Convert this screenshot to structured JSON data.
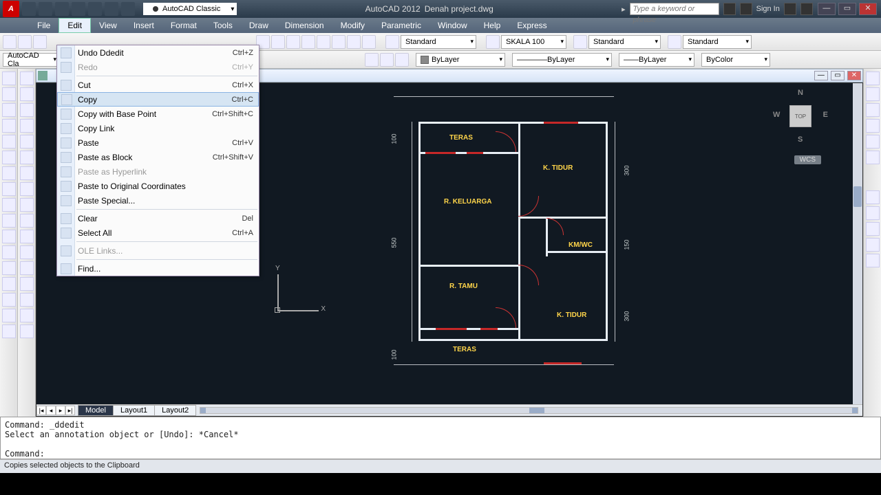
{
  "title_app": "AutoCAD 2012",
  "title_file": "Denah project.dwg",
  "workspace": "AutoCAD Classic",
  "search_ph": "Type a keyword or phrase",
  "signin": "Sign In",
  "menu": [
    "File",
    "Edit",
    "View",
    "Insert",
    "Format",
    "Tools",
    "Draw",
    "Dimension",
    "Modify",
    "Parametric",
    "Window",
    "Help",
    "Express"
  ],
  "edit_menu": [
    {
      "t": "section",
      "items": [
        {
          "label": "Undo Ddedit",
          "sc": "Ctrl+Z"
        },
        {
          "label": "Redo",
          "sc": "Ctrl+Y",
          "dis": true
        }
      ]
    },
    {
      "t": "section",
      "items": [
        {
          "label": "Cut",
          "sc": "Ctrl+X"
        },
        {
          "label": "Copy",
          "sc": "Ctrl+C",
          "hi": true
        },
        {
          "label": "Copy with Base Point",
          "sc": "Ctrl+Shift+C"
        },
        {
          "label": "Copy Link",
          "sc": ""
        },
        {
          "label": "Paste",
          "sc": "Ctrl+V"
        },
        {
          "label": "Paste as Block",
          "sc": "Ctrl+Shift+V"
        },
        {
          "label": "Paste as Hyperlink",
          "sc": "",
          "dis": true
        },
        {
          "label": "Paste to Original Coordinates",
          "sc": ""
        },
        {
          "label": "Paste Special...",
          "sc": ""
        }
      ]
    },
    {
      "t": "section",
      "items": [
        {
          "label": "Clear",
          "sc": "Del"
        },
        {
          "label": "Select All",
          "sc": "Ctrl+A"
        }
      ]
    },
    {
      "t": "section",
      "items": [
        {
          "label": "OLE Links...",
          "sc": "",
          "dis": true
        }
      ]
    },
    {
      "t": "section",
      "items": [
        {
          "label": "Find...",
          "sc": ""
        }
      ]
    }
  ],
  "combos": {
    "textstyle": "Standard",
    "dimstyle": "SKALA 100",
    "tablestyle": "Standard",
    "mlstyle": "Standard",
    "layer": "ByLayer",
    "lwt": "ByLayer",
    "ltype": "ByLayer",
    "color": "ByColor",
    "workspace2": "AutoCAD Cla"
  },
  "rooms": {
    "teras": "TERAS",
    "keluarga": "R. KELUARGA",
    "tamu": "R. TAMU",
    "tidur": "K. TIDUR",
    "kmwc": "KM/WC"
  },
  "dims": {
    "d100": "100",
    "d550": "550",
    "d300": "300",
    "d150": "150"
  },
  "tabs": {
    "model": "Model",
    "l1": "Layout1",
    "l2": "Layout2"
  },
  "cmd": "Command: _ddedit\nSelect an annotation object or [Undo]: *Cancel*\n\nCommand:",
  "status": "Copies selected objects to the Clipboard",
  "viewcube": {
    "top": "TOP",
    "n": "N",
    "s": "S",
    "e": "E",
    "w": "W"
  },
  "wcs": "WCS"
}
